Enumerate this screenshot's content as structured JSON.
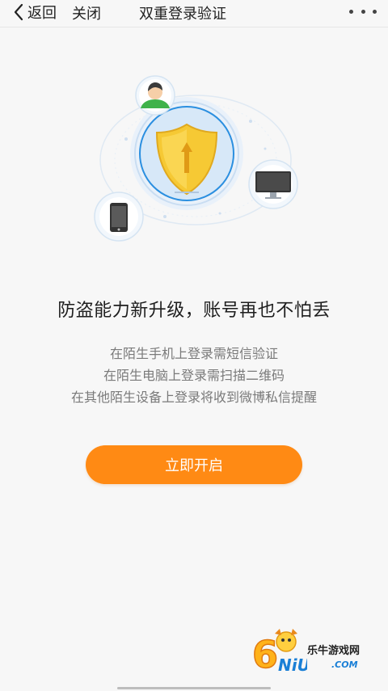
{
  "nav": {
    "back_label": "返回",
    "close_label": "关闭",
    "title": "双重登录验证"
  },
  "illustration": {
    "icons": [
      "user-avatar-icon",
      "shield-icon",
      "monitor-icon",
      "phone-icon"
    ],
    "colors": {
      "shield": "#f6c934",
      "ring": "#cfe3f7",
      "accent": "#2b8fe0"
    }
  },
  "headline": "防盗能力新升级，账号再也不怕丢",
  "descriptions": [
    "在陌生手机上登录需短信验证",
    "在陌生电脑上登录需扫描二维码",
    "在其他陌生设备上登录将收到微博私信提醒"
  ],
  "cta": {
    "label": "立即开启",
    "color": "#ff8a14"
  },
  "watermark": {
    "site_name": "乐牛游戏网",
    "brand_mark": "6NiU",
    "domain": ".COM"
  }
}
